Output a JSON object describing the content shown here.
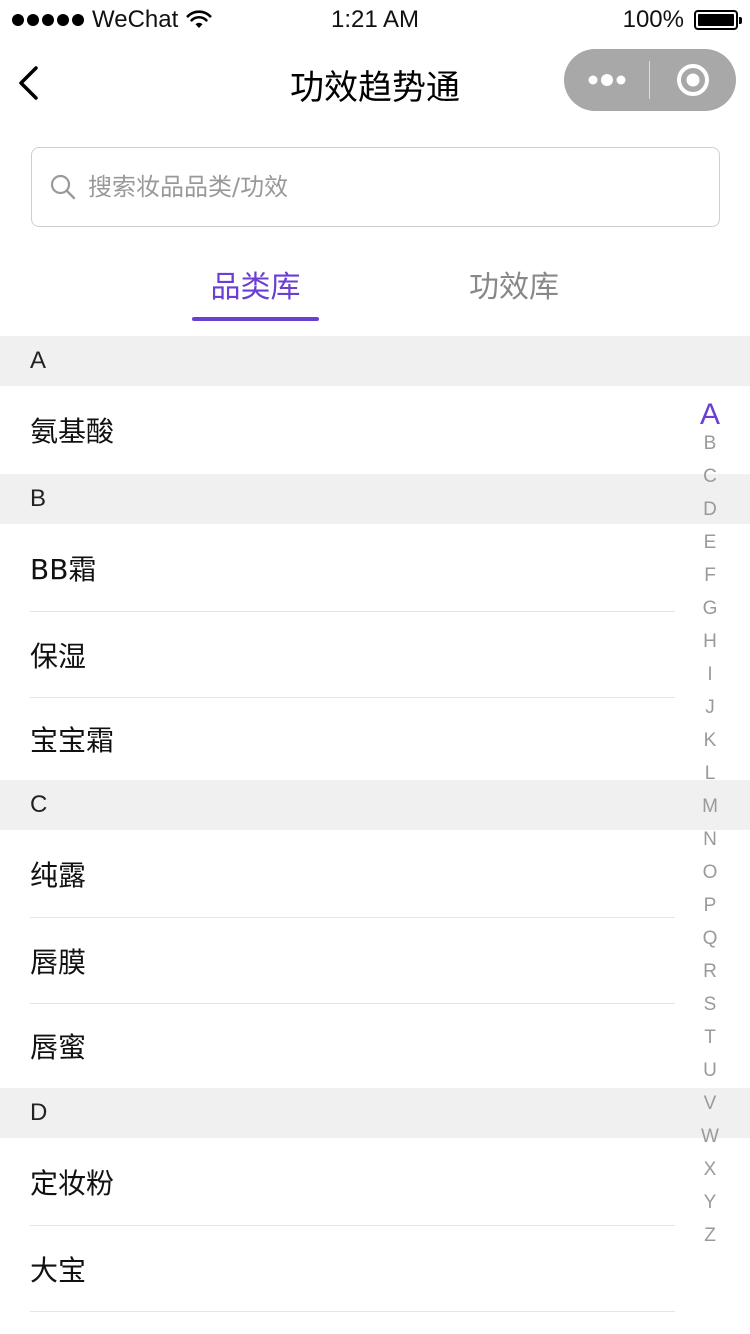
{
  "status_bar": {
    "carrier": "WeChat",
    "time": "1:21 AM",
    "battery": "100%"
  },
  "nav": {
    "title": "功效趋势通"
  },
  "search": {
    "placeholder": "搜索妆品品类/功效"
  },
  "tabs": [
    {
      "label": "品类库",
      "active": true
    },
    {
      "label": "功效库",
      "active": false
    }
  ],
  "sections": [
    {
      "letter": "A",
      "items": [
        "氨基酸"
      ]
    },
    {
      "letter": "B",
      "items": [
        "BB霜",
        "保湿",
        "宝宝霜"
      ]
    },
    {
      "letter": "C",
      "items": [
        "纯露",
        "唇膜",
        "唇蜜"
      ]
    },
    {
      "letter": "D",
      "items": [
        "定妆粉",
        "大宝"
      ]
    }
  ],
  "alphabet": [
    "A",
    "B",
    "C",
    "D",
    "E",
    "F",
    "G",
    "H",
    "I",
    "J",
    "K",
    "L",
    "M",
    "N",
    "O",
    "P",
    "Q",
    "R",
    "S",
    "T",
    "U",
    "V",
    "W",
    "X",
    "Y",
    "Z"
  ],
  "alphabet_active": "A",
  "colors": {
    "accent": "#6b3fd3",
    "section_bg": "#f0f0f0",
    "capsule_bg": "#a8a8a8"
  }
}
